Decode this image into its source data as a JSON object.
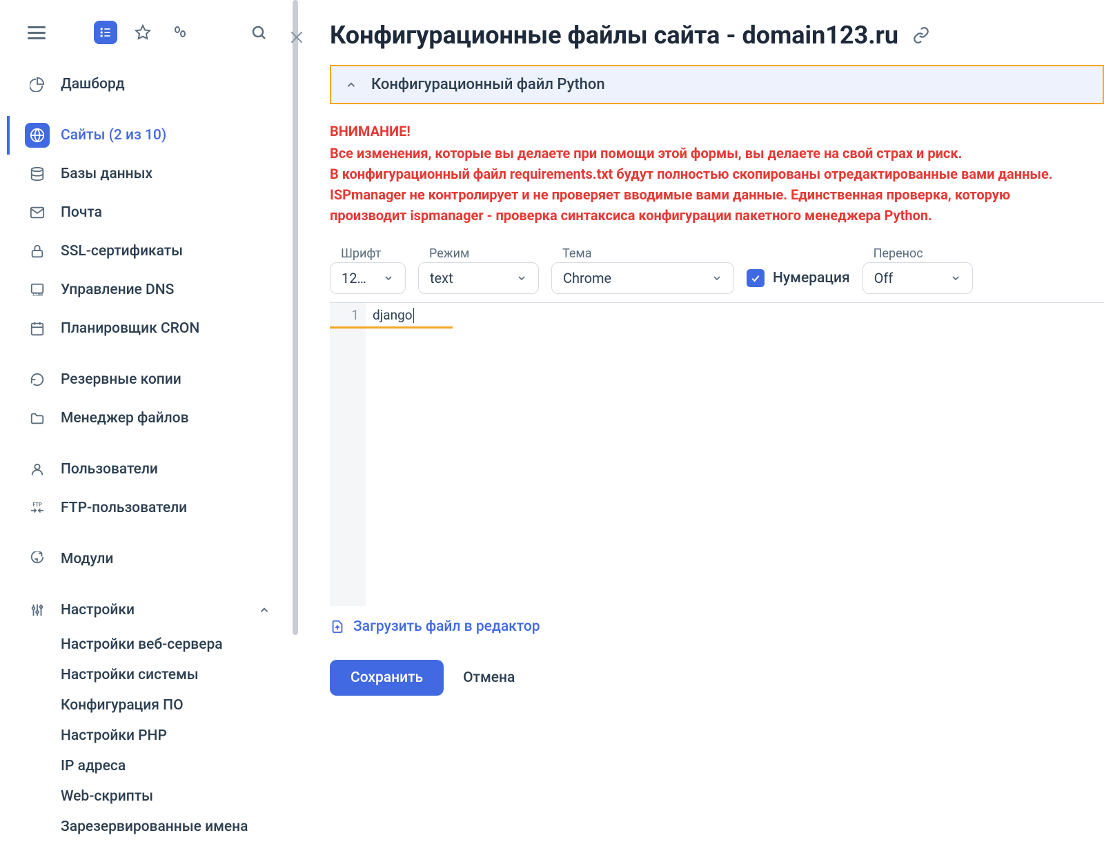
{
  "sidebar": {
    "items": [
      {
        "label": "Дашборд"
      },
      {
        "label": "Сайты (2 из 10)"
      },
      {
        "label": "Базы данных"
      },
      {
        "label": "Почта"
      },
      {
        "label": "SSL-сертификаты"
      },
      {
        "label": "Управление DNS"
      },
      {
        "label": "Планировщик CRON"
      },
      {
        "label": "Резервные копии"
      },
      {
        "label": "Менеджер файлов"
      },
      {
        "label": "Пользователи"
      },
      {
        "label": "FTP-пользователи"
      },
      {
        "label": "Модули"
      },
      {
        "label": "Настройки"
      }
    ],
    "sub": [
      {
        "label": "Настройки веб-сервера"
      },
      {
        "label": "Настройки системы"
      },
      {
        "label": "Конфигурация ПО"
      },
      {
        "label": "Настройки PHP"
      },
      {
        "label": "IP адреса"
      },
      {
        "label": "Web-скрипты"
      },
      {
        "label": "Зарезервированные имена"
      }
    ]
  },
  "page": {
    "title": "Конфигурационные файлы сайта - domain123.ru",
    "accordion_title": "Конфигурационный файл Python"
  },
  "warning": {
    "heading": "ВНИМАНИЕ!",
    "p1": "Все изменения, которые вы делаете при помощи этой формы, вы делаете на свой страх и риск.",
    "p2": "В конфигурационный файл requirements.txt будут полностью скопированы отредактированные вами данные.",
    "p3": "ISPmanager не контролирует и не проверяет вводимые вами данные. Единственная проверка, которую производит ispmanager - проверка синтаксиса конфигурации пакетного менеджера Python."
  },
  "controls": {
    "font_label": "Шрифт",
    "font_value": "12…",
    "mode_label": "Режим",
    "mode_value": "text",
    "theme_label": "Тема",
    "theme_value": "Chrome",
    "numbering_label": "Нумерация",
    "wrap_label": "Перенос",
    "wrap_value": "Off"
  },
  "editor": {
    "line1_number": "1",
    "line1_text": "django"
  },
  "actions": {
    "upload": "Загрузить файл в редактор",
    "save": "Сохранить",
    "cancel": "Отмена"
  }
}
